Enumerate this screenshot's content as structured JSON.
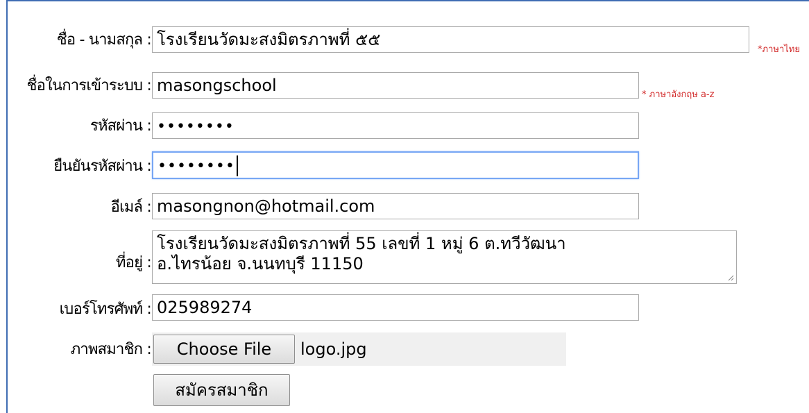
{
  "form": {
    "fullname": {
      "label": "ชื่อ - นามสกุล :",
      "value": "โรงเรียนวัดมะสงมิตรภาพที่ ๕๕",
      "hint": "*ภาษาไทย"
    },
    "username": {
      "label": "ชื่อในการเข้าระบบ :",
      "value": "masongschool",
      "hint": "* ภาษาอังกฤษ a-z"
    },
    "password": {
      "label": "รหัสผ่าน :",
      "value": "••••••••"
    },
    "confirm_password": {
      "label": "ยืนยันรหัสผ่าน :",
      "value": "••••••••"
    },
    "email": {
      "label": "อีเมล์ :",
      "value": "masongnon@hotmail.com"
    },
    "address": {
      "label": "ที่อยู่ :",
      "line1": "โรงเรียนวัดมะสงมิตรภาพที่ 55  เลขที่  1 หมู่ 6 ต.ทวีวัฒนา",
      "line2": "อ.ไทรน้อย จ.นนทบุรี 11150"
    },
    "phone": {
      "label": "เบอร์โทรศัพท์ :",
      "value": "025989274"
    },
    "photo": {
      "label": "ภาพสมาชิก :",
      "button": "Choose File",
      "filename": "logo.jpg"
    },
    "submit_label": "สมัครสมาชิก"
  },
  "colors": {
    "frame": "#3f6db3",
    "hint": "#d22a2a",
    "focus": "#77a6f4"
  }
}
